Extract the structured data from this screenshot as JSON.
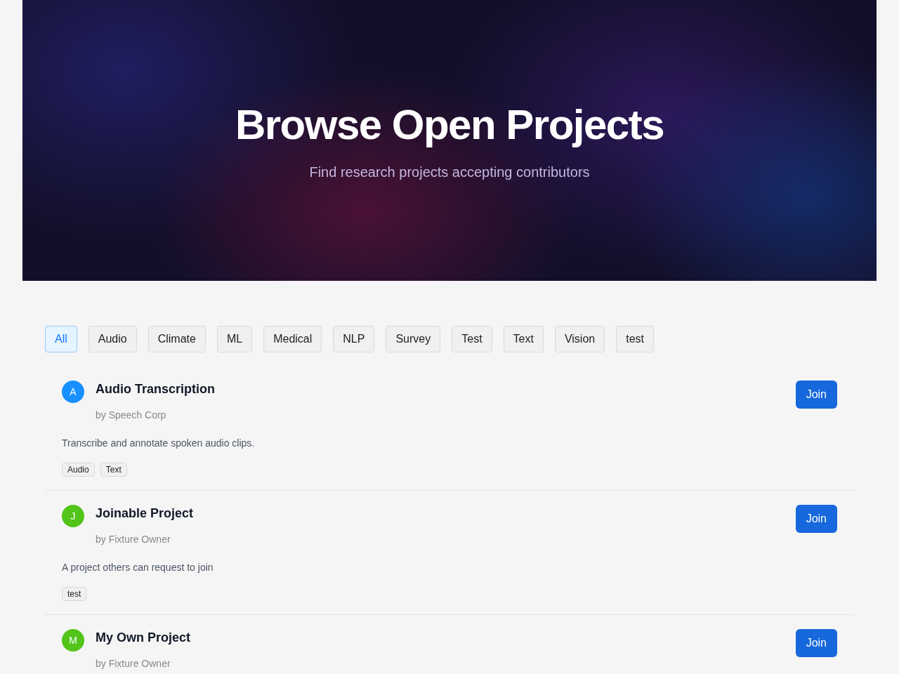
{
  "hero": {
    "title": "Browse Open Projects",
    "subtitle": "Find research projects accepting contributors"
  },
  "filters": [
    {
      "label": "All",
      "selected": true
    },
    {
      "label": "Audio",
      "selected": false
    },
    {
      "label": "Climate",
      "selected": false
    },
    {
      "label": "ML",
      "selected": false
    },
    {
      "label": "Medical",
      "selected": false
    },
    {
      "label": "NLP",
      "selected": false
    },
    {
      "label": "Survey",
      "selected": false
    },
    {
      "label": "Test",
      "selected": false
    },
    {
      "label": "Text",
      "selected": false
    },
    {
      "label": "Vision",
      "selected": false
    },
    {
      "label": "test",
      "selected": false
    }
  ],
  "projects": [
    {
      "initial": "A",
      "color": "#1890ff",
      "title": "Audio Transcription",
      "owner": "by Speech Corp",
      "description": "Transcribe and annotate spoken audio clips.",
      "tags": [
        "Audio",
        "Text"
      ],
      "action": "Join"
    },
    {
      "initial": "J",
      "color": "#52c41a",
      "title": "Joinable Project",
      "owner": "by Fixture Owner",
      "description": "A project others can request to join",
      "tags": [
        "test"
      ],
      "action": "Join"
    },
    {
      "initial": "M",
      "color": "#52c41a",
      "title": "My Own Project",
      "owner": "by Fixture Owner",
      "action": "Join"
    }
  ]
}
